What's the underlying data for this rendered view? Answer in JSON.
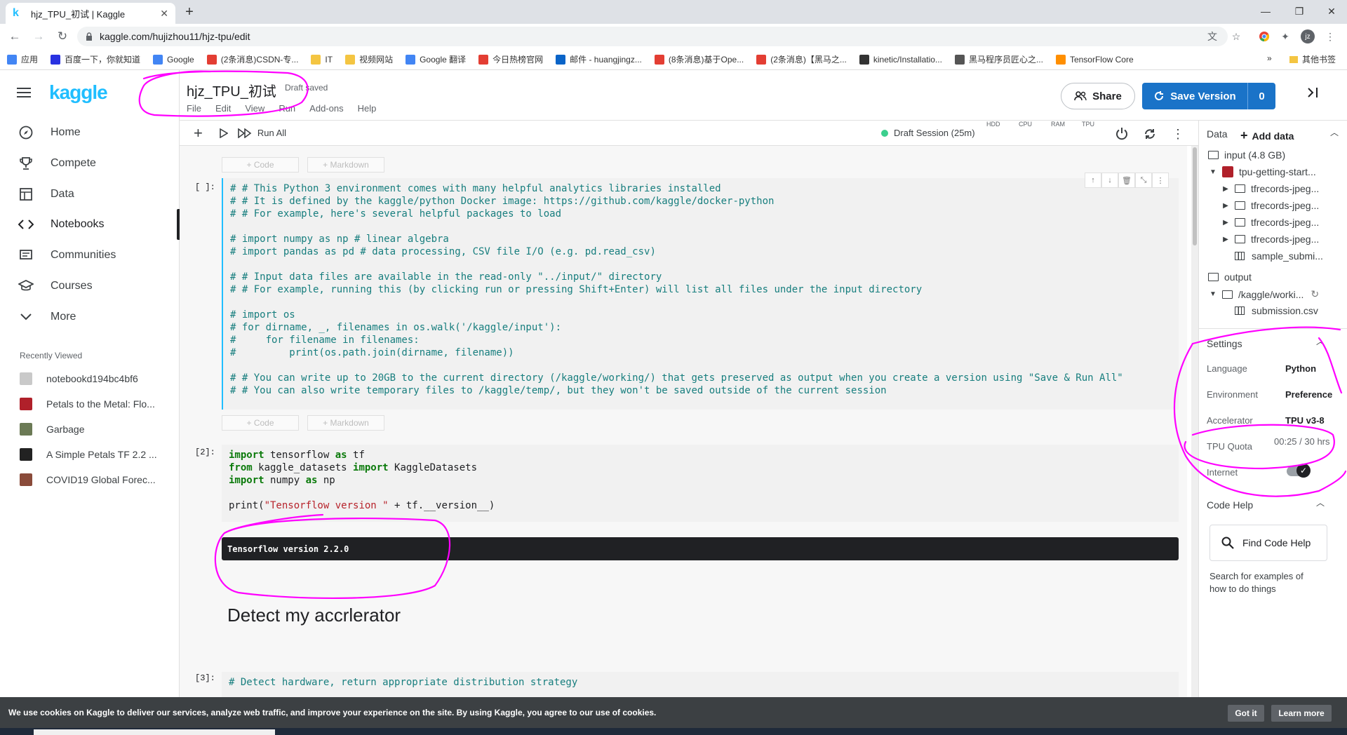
{
  "browser": {
    "tab_title": "hjz_TPU_初试 | Kaggle",
    "tab_favicon": "k",
    "url": "kaggle.com/hujizhou11/hjz-tpu/edit",
    "profile_initials": "jz",
    "bookmarks": [
      {
        "label": "应用",
        "color": "#4285f4"
      },
      {
        "label": "百度一下，你就知道",
        "color": "#2932e1"
      },
      {
        "label": "Google",
        "color": "#4285f4"
      },
      {
        "label": "(2条消息)CSDN-专...",
        "color": "#e33e33"
      },
      {
        "label": "IT",
        "color": "#f4c542"
      },
      {
        "label": "视频网站",
        "color": "#f4c542"
      },
      {
        "label": "Google 翻译",
        "color": "#4285f4"
      },
      {
        "label": "今日热榜官网",
        "color": "#e33e33"
      },
      {
        "label": "邮件 - huangjingz...",
        "color": "#0a64c8"
      },
      {
        "label": "(8条消息)基于Ope...",
        "color": "#e33e33"
      },
      {
        "label": "(2条消息)【黑马之...",
        "color": "#e33e33"
      },
      {
        "label": "kinetic/Installatio...",
        "color": "#333333"
      },
      {
        "label": "黑马程序员匠心之...",
        "color": "#555555"
      },
      {
        "label": "TensorFlow Core",
        "color": "#ff8f00"
      }
    ],
    "bookmarks_other": "其他书签"
  },
  "kaggle": {
    "logo": "kaggle",
    "nav": [
      {
        "label": "Home",
        "icon": "compass-icon"
      },
      {
        "label": "Compete",
        "icon": "trophy-icon"
      },
      {
        "label": "Data",
        "icon": "table-icon"
      },
      {
        "label": "Notebooks",
        "icon": "code-icon"
      },
      {
        "label": "Communities",
        "icon": "comments-icon"
      },
      {
        "label": "Courses",
        "icon": "school-icon"
      },
      {
        "label": "More",
        "icon": "chevron-down-icon"
      }
    ],
    "recent_header": "Recently Viewed",
    "recent": [
      {
        "label": "notebookd194bc4bf6",
        "thumb": "#c9c9c9"
      },
      {
        "label": "Petals to the Metal: Flo...",
        "thumb": "#b0202a"
      },
      {
        "label": "Garbage",
        "thumb": "#6b7a55"
      },
      {
        "label": "A Simple Petals TF 2.2 ...",
        "thumb": "#222222"
      },
      {
        "label": "COVID19 Global Forec...",
        "thumb": "#8a4b3a"
      }
    ]
  },
  "header": {
    "title": "hjz_TPU_初试",
    "draft_status": "Draft saved",
    "menu": [
      "File",
      "Edit",
      "View",
      "Run",
      "Add-ons",
      "Help"
    ],
    "share_label": "Share",
    "save_label": "Save Version",
    "save_count": "0"
  },
  "toolbar": {
    "run_all": "Run All",
    "session": "Draft Session (25m)",
    "meters": [
      "HDD",
      "CPU",
      "RAM",
      "TPU"
    ]
  },
  "cells": {
    "add_code": "+ Code",
    "add_markdown": "+ Markdown",
    "cell1_prompt": "[ ]:",
    "cell1_lines": [
      "# # This Python 3 environment comes with many helpful analytics libraries installed",
      "# # It is defined by the kaggle/python Docker image: https://github.com/kaggle/docker-python",
      "# # For example, here's several helpful packages to load",
      "",
      "# import numpy as np # linear algebra",
      "# import pandas as pd # data processing, CSV file I/O (e.g. pd.read_csv)",
      "",
      "# # Input data files are available in the read-only \"../input/\" directory",
      "# # For example, running this (by clicking run or pressing Shift+Enter) will list all files under the input directory",
      "",
      "# import os",
      "# for dirname, _, filenames in os.walk('/kaggle/input'):",
      "#     for filename in filenames:",
      "#         print(os.path.join(dirname, filename))",
      "",
      "# # You can write up to 20GB to the current directory (/kaggle/working/) that gets preserved as output when you create a version using \"Save & Run All\"",
      "# # You can also write temporary files to /kaggle/temp/, but they won't be saved outside of the current session"
    ],
    "cell2_prompt": "[2]:",
    "cell2": {
      "l1_kw": "import",
      "l1_rest": " tensorflow ",
      "l1_kw2": "as",
      "l1_end": " tf",
      "l2_kw": "from",
      "l2_rest": " kaggle_datasets ",
      "l2_kw2": "import",
      "l2_end": " KaggleDatasets",
      "l3_kw": "import",
      "l3_rest": " numpy ",
      "l3_kw2": "as",
      "l3_end": " np",
      "l5_a": "print(",
      "l5_str": "\"Tensorflow version \"",
      "l5_b": " + tf.__version__)"
    },
    "output": "Tensorflow version 2.2.0",
    "markdown_heading": "Detect my accrlerator",
    "cell3_prompt": "[3]:",
    "cell3_line": "# Detect hardware, return appropriate distribution strategy"
  },
  "right_panel": {
    "data_label": "Data",
    "add_data": "Add data",
    "input_label": "input (4.8 GB)",
    "dataset": "tpu-getting-start...",
    "folders": [
      "tfrecords-jpeg...",
      "tfrecords-jpeg...",
      "tfrecords-jpeg...",
      "tfrecords-jpeg..."
    ],
    "sample_file": "sample_submi...",
    "output_label": "output",
    "working": "/kaggle/worki...",
    "submission": "submission.csv",
    "settings_label": "Settings",
    "settings": [
      {
        "label": "Language",
        "value": "Python"
      },
      {
        "label": "Environment",
        "value": "Preference"
      },
      {
        "label": "Accelerator",
        "value": "TPU v3-8"
      },
      {
        "label": "TPU Quota",
        "value": "00:25 / 30 hrs"
      },
      {
        "label": "Internet",
        "value": ""
      }
    ],
    "internet_on": true,
    "code_help_label": "Code Help",
    "find_help": "Find Code Help",
    "help_text_1": "Search for examples of",
    "help_text_2": "how to do things"
  },
  "cookie": {
    "text": "We use cookies on Kaggle to deliver our services, analyze web traffic, and improve your experience on the site. By using Kaggle, you agree to our use of cookies.",
    "got_it": "Got it",
    "learn_more": "Learn more"
  },
  "colors": {
    "kaggle_blue": "#20beff",
    "save_blue": "#1a73c8",
    "annotation_magenta": "#ff00ff"
  }
}
